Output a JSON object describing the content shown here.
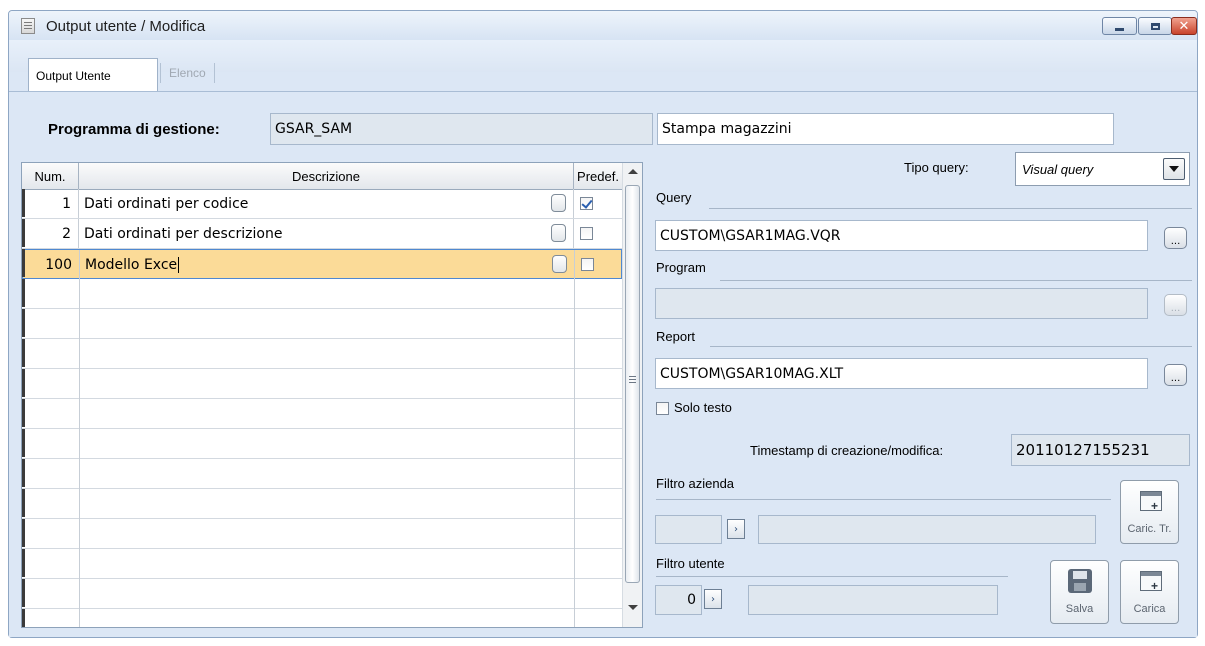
{
  "window": {
    "title": "Output utente / Modifica",
    "tabs": [
      {
        "label": "Output Utente",
        "active": true
      },
      {
        "label": "Elenco",
        "active": false
      }
    ]
  },
  "form": {
    "programma_label": "Programma di gestione:",
    "programma_value": "GSAR_SAM",
    "programma_desc": "Stampa magazzini",
    "tipo_query_label": "Tipo query:",
    "tipo_query_value": "Visual query",
    "query_label": "Query",
    "query_value": "CUSTOM\\GSAR1MAG.VQR",
    "program_label": "Program",
    "program_value": "",
    "report_label": "Report",
    "report_value": "CUSTOM\\GSAR10MAG.XLT",
    "solo_testo_label": "Solo testo",
    "solo_testo_checked": false,
    "timestamp_label": "Timestamp di creazione/modifica:",
    "timestamp_value": "20110127155231",
    "filtro_azienda_label": "Filtro azienda",
    "filtro_azienda_code": "",
    "filtro_azienda_desc": "",
    "filtro_utente_label": "Filtro utente",
    "filtro_utente_code": "0",
    "filtro_utente_desc": "",
    "browse_glyph": "...",
    "link_glyph": "›"
  },
  "grid": {
    "columns": [
      "Num.",
      "Descrizione",
      "Predef."
    ],
    "rows": [
      {
        "num": "1",
        "descrizione": "Dati ordinati per codice",
        "predef": true
      },
      {
        "num": "2",
        "descrizione": "Dati ordinati per descrizione",
        "predef": false
      },
      {
        "num": "100",
        "descrizione": "Modello Exce",
        "predef": false
      }
    ]
  },
  "buttons": {
    "caric_tr": "Caric. Tr.",
    "salva": "Salva",
    "carica": "Carica"
  }
}
